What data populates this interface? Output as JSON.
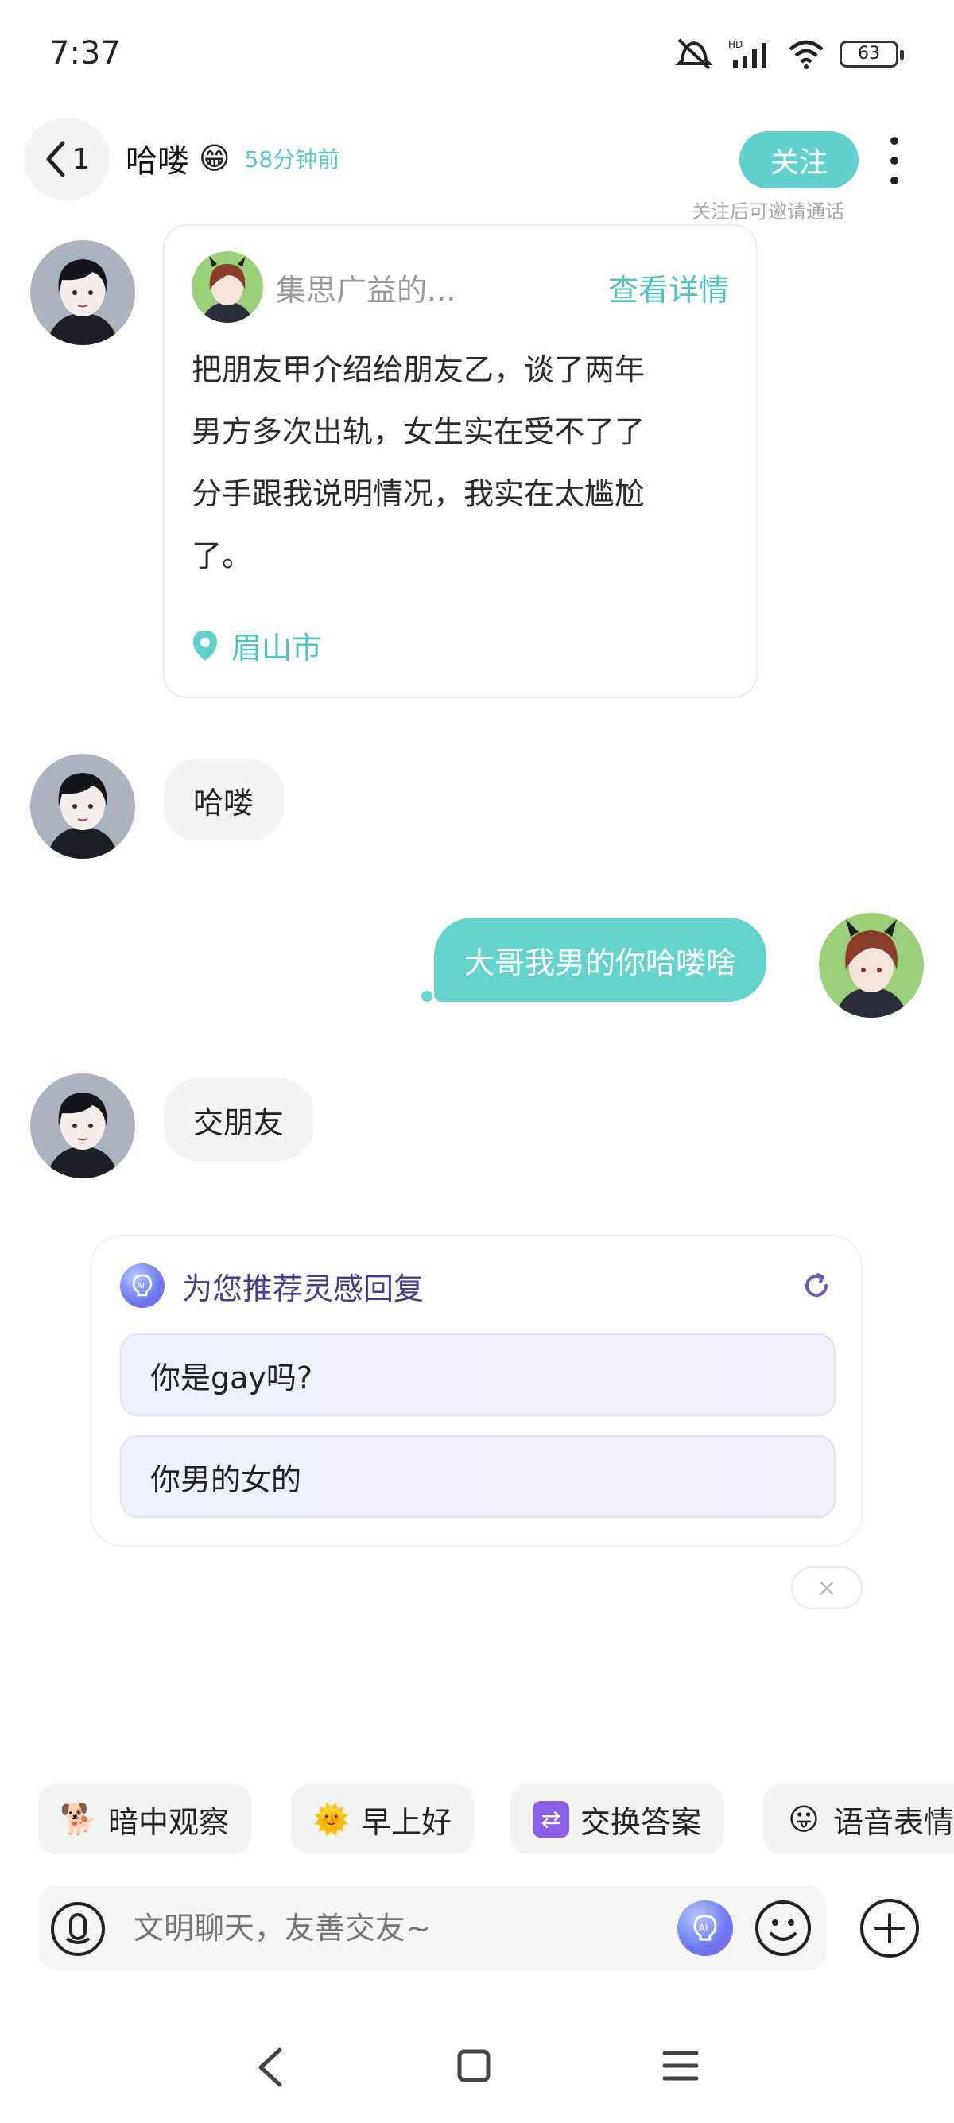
{
  "status_bar": {
    "time": "7:37",
    "battery": "63"
  },
  "header": {
    "back_count": "1",
    "title": "哈喽",
    "title_emoji": "😁",
    "last_seen": "58分钟前",
    "follow_label": "关注",
    "follow_hint": "关注后可邀请通话"
  },
  "intro_card": {
    "name": "集思广益的...",
    "detail_label": "查看详情",
    "text_lines": [
      "把朋友甲介绍给朋友乙，谈了两年",
      "男方多次出轨，女生实在受不了了",
      "分手跟我说明情况，我实在太尴尬",
      "了。"
    ],
    "location": "眉山市"
  },
  "messages": [
    {
      "side": "left",
      "text": "哈喽"
    },
    {
      "side": "right",
      "text": "大哥我男的你哈喽啥"
    },
    {
      "side": "left",
      "text": "交朋友"
    }
  ],
  "recommend": {
    "title": "为您推荐灵感回复",
    "items": [
      "你是gay吗?",
      "你男的女的"
    ],
    "close_label": "×"
  },
  "chips": [
    {
      "icon": "observe-icon",
      "glyph": "🐕",
      "label": "暗中观察"
    },
    {
      "icon": "sun-icon",
      "glyph": "🌞",
      "label": "早上好"
    },
    {
      "icon": "swap-icon",
      "glyph": "⇄",
      "label": "交换答案"
    },
    {
      "icon": "voice-emoji-icon",
      "glyph": "😛",
      "label": "语音表情"
    }
  ],
  "input": {
    "placeholder": "文明聊天，友善交友~"
  },
  "colors": {
    "accent": "#5fd0cb",
    "ai_purple": "#4a3a8e"
  }
}
